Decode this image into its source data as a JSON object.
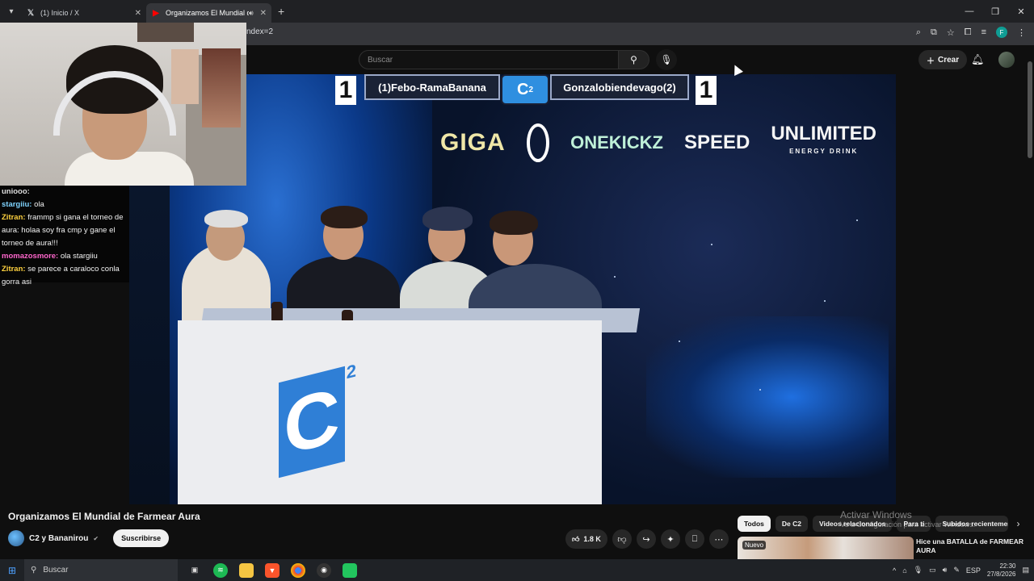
{
  "browser": {
    "tabs": [
      {
        "title": "(1) Inicio / X",
        "icon": "x-logo-icon",
        "active": false
      },
      {
        "title": "Organizamos El Mundial de Farmear Aura",
        "icon": "youtube-icon",
        "active": true
      }
    ],
    "url": "ndex=2",
    "profile_initial": "F"
  },
  "youtube": {
    "search_placeholder": "Buscar",
    "create_label": "Crear"
  },
  "video": {
    "overlay": {
      "left_score": "1",
      "left_player": "(1)Febo-RamaBanana",
      "center_logo": "C",
      "center_logo_sup": "2",
      "right_player": "Gonzalobiendevago(2)",
      "right_score": "1"
    },
    "sponsors": {
      "giga": "GIGA",
      "onekickz": "ONEKICKZ",
      "speed": "SPEED",
      "unlimited": "UNLIMITED",
      "unlimited_sub": "ENERGY DRINK"
    },
    "table_logo": "C",
    "table_logo_sup": "2",
    "title": "Organizamos El Mundial de Farmear Aura",
    "channel": "C2 y Bananirou",
    "subscribe_label": "Suscribirse",
    "likes": "1.8 K"
  },
  "chat": [
    {
      "user": "uniooo:",
      "message": "",
      "user_color": "#dddddd"
    },
    {
      "user": "stargiiu:",
      "message": "ola",
      "user_color": "#7fd3ff"
    },
    {
      "user": "Zitran:",
      "message": "frammp si gana el torneo de aura: holaa soy fra cmp y gane el torneo de aura!!!",
      "user_color": "#ffd23f"
    },
    {
      "user": "momazosmore:",
      "message": "ola stargiiu",
      "user_color": "#ff66cc"
    },
    {
      "user": "Zitran:",
      "message": "se parece a caraloco conla gorra asi",
      "user_color": "#ffd23f"
    }
  ],
  "filter_chips": [
    "Todos",
    "De C2",
    "Videos relacionados",
    "Para ti",
    "Subidos recientemente"
  ],
  "recommendation": {
    "badge": "Nuevo",
    "title": "Hice una BATALLA de FARMEAR AURA"
  },
  "watermark": {
    "line1": "Activar Windows",
    "line2": "Ve a Configuración para activar Windows."
  },
  "taskbar": {
    "search_placeholder": "Buscar",
    "language": "ESP",
    "time": "22:30",
    "date": "27/8/2026"
  },
  "colors": {
    "youtube_bg": "#0f0f0f",
    "accent_blue": "#2f8fe0",
    "chrome_tab_bg": "#202124"
  }
}
